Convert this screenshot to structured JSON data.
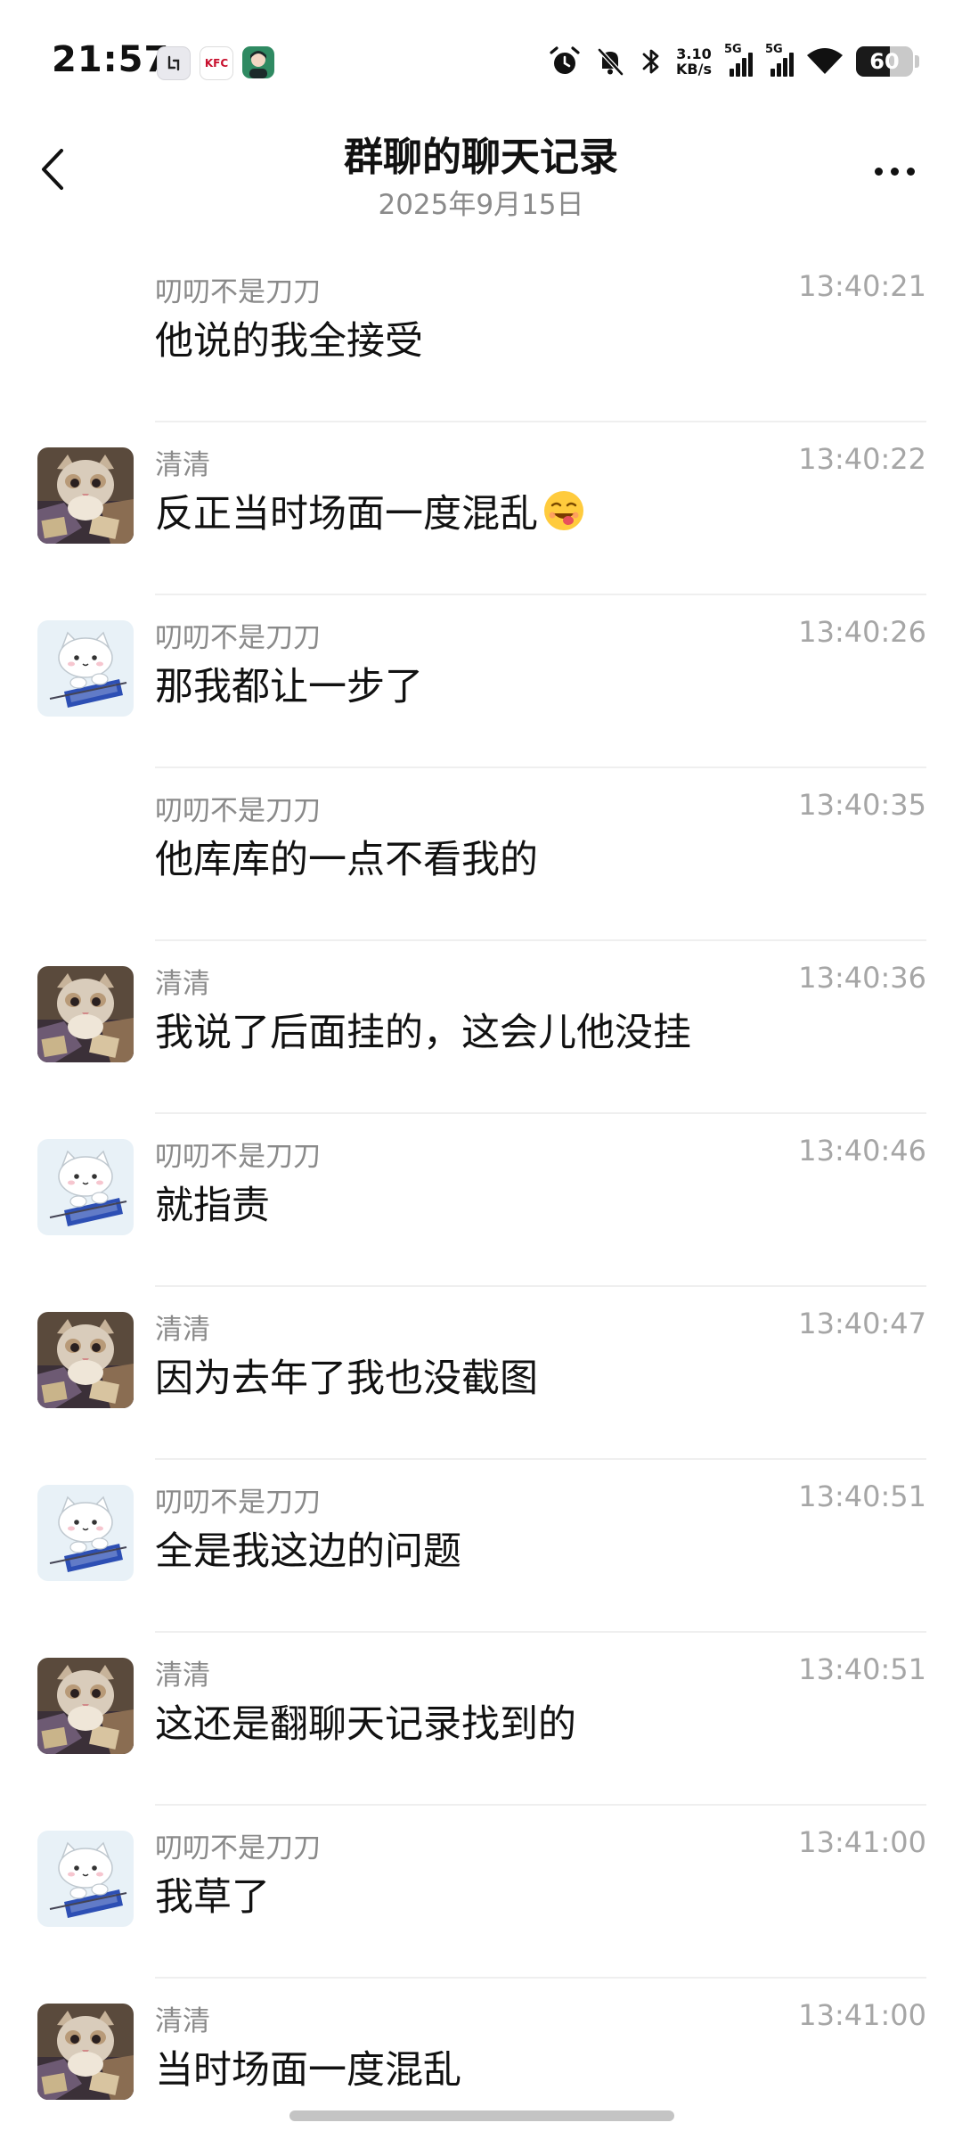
{
  "status_bar": {
    "time": "21:57",
    "notification_icons": [
      "app-notification-icon",
      "kfc-notification-icon",
      "avatar-notification-icon"
    ],
    "kfc_label": "KFC",
    "net_speed_value": "3.10",
    "net_speed_unit": "KB/s",
    "sim1_label": "5G",
    "sim2_label": "5G",
    "battery_level": "60",
    "battery_fraction": 0.6
  },
  "header": {
    "title": "群聊的聊天记录",
    "subtitle": "2025年9月15日"
  },
  "messages": [
    {
      "sender": "叨叨不是刀刀",
      "time": "13:40:21",
      "text": "他说的我全接受",
      "avatar": "none"
    },
    {
      "sender": "清清",
      "time": "13:40:22",
      "text": "反正当时场面一度混乱",
      "avatar": "cat-photo",
      "emoji": "grinning-tongue-emoji"
    },
    {
      "sender": "叨叨不是刀刀",
      "time": "13:40:26",
      "text": "那我都让一步了",
      "avatar": "cartoon-cat"
    },
    {
      "sender": "叨叨不是刀刀",
      "time": "13:40:35",
      "text": "他库库的一点不看我的",
      "avatar": "none"
    },
    {
      "sender": "清清",
      "time": "13:40:36",
      "text": "我说了后面挂的，这会儿他没挂",
      "avatar": "cat-photo"
    },
    {
      "sender": "叨叨不是刀刀",
      "time": "13:40:46",
      "text": "就指责",
      "avatar": "cartoon-cat"
    },
    {
      "sender": "清清",
      "time": "13:40:47",
      "text": "因为去年了我也没截图",
      "avatar": "cat-photo"
    },
    {
      "sender": "叨叨不是刀刀",
      "time": "13:40:51",
      "text": "全是我这边的问题",
      "avatar": "cartoon-cat"
    },
    {
      "sender": "清清",
      "time": "13:40:51",
      "text": "这还是翻聊天记录找到的",
      "avatar": "cat-photo"
    },
    {
      "sender": "叨叨不是刀刀",
      "time": "13:41:00",
      "text": "我草了",
      "avatar": "cartoon-cat"
    },
    {
      "sender": "清清",
      "time": "13:41:00",
      "text": "当时场面一度混乱",
      "avatar": "cat-photo"
    }
  ],
  "colors": {
    "background": "#ffffff",
    "primary_text": "#111111",
    "secondary_text": "#8a8a8a",
    "time_text": "#a6a6a6",
    "divider": "#efefef"
  }
}
